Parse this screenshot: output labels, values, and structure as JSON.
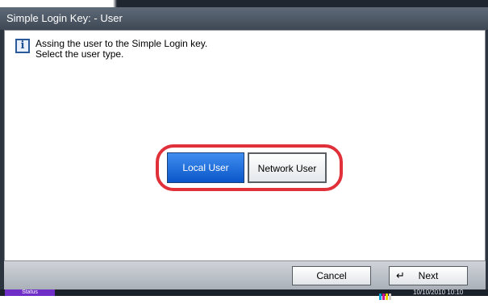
{
  "window": {
    "title": "Simple Login Key: - User"
  },
  "message": {
    "line1": "Assing the user to the Simple Login key.",
    "line2": "Select the user type."
  },
  "user_type": {
    "local_label": "Local User",
    "network_label": "Network User",
    "selected": "Local User"
  },
  "footer": {
    "cancel_label": "Cancel",
    "next_label": "Next"
  },
  "statusbar": {
    "status_label": "Status",
    "datetime": "10/10/2010 10:10"
  },
  "colors": {
    "selected_button": "#0a56c9",
    "highlight_ring": "#e0303a",
    "status_button": "#6f2ec7"
  }
}
